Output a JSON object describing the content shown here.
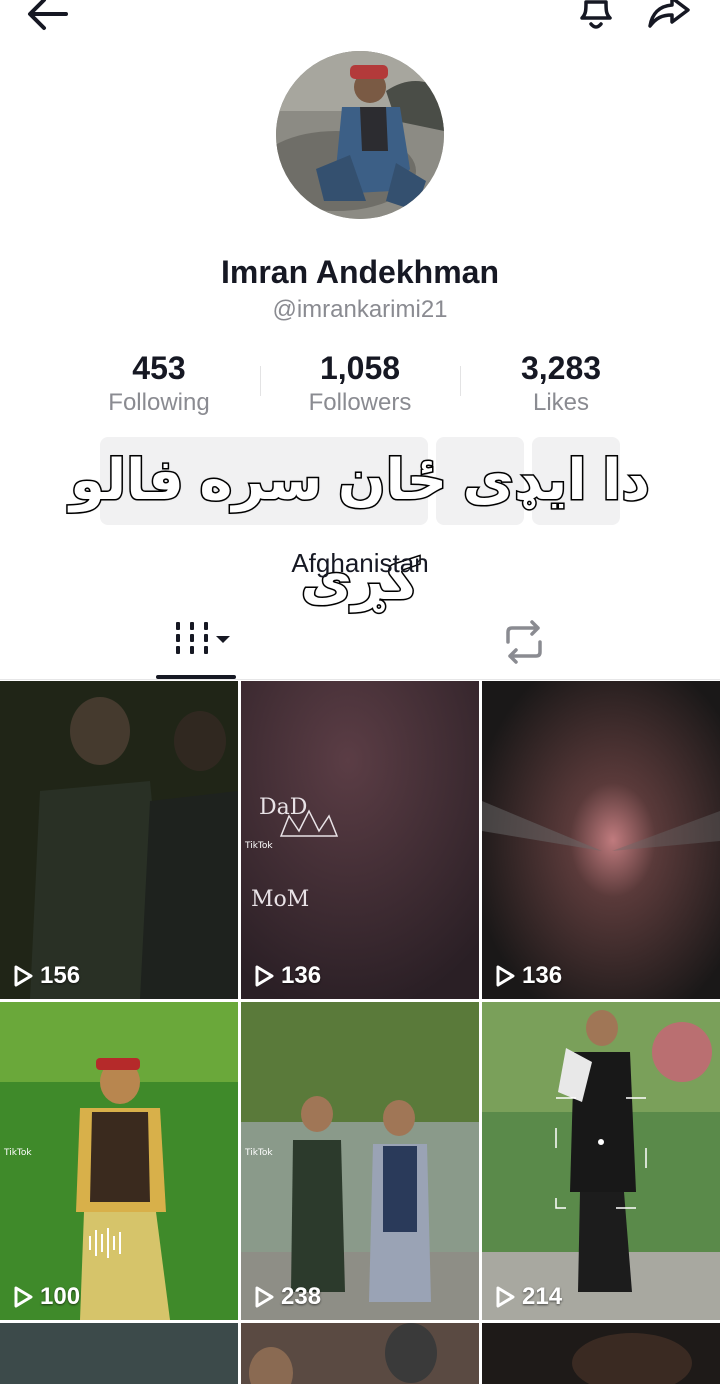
{
  "profile": {
    "display_name": "Imran Andekhman",
    "username": "@imrankarimi21",
    "location": "Afghanistan"
  },
  "stats": [
    {
      "value": "453",
      "label": "Following"
    },
    {
      "value": "1,058",
      "label": "Followers"
    },
    {
      "value": "3,283",
      "label": "Likes"
    }
  ],
  "overlay_caption": "دا ایډی ځان سره فالو کړی",
  "icons": {
    "back": "back-arrow-icon",
    "bell": "bell-icon",
    "share": "share-icon",
    "videos_tab": "grid-icon",
    "reposts_tab": "repost-icon",
    "play": "play-icon"
  },
  "videos": [
    {
      "views": "156"
    },
    {
      "views": "136",
      "caption_top": "DaD",
      "caption_bottom": "MoM",
      "watermark": "TikTok"
    },
    {
      "views": "136"
    },
    {
      "views": "100",
      "watermark": "TikTok"
    },
    {
      "views": "238",
      "watermark": "TikTok"
    },
    {
      "views": "214"
    }
  ],
  "colors": {
    "text_primary": "#161823",
    "text_secondary": "#8a8b91",
    "button_bg": "#f1f1f2"
  }
}
